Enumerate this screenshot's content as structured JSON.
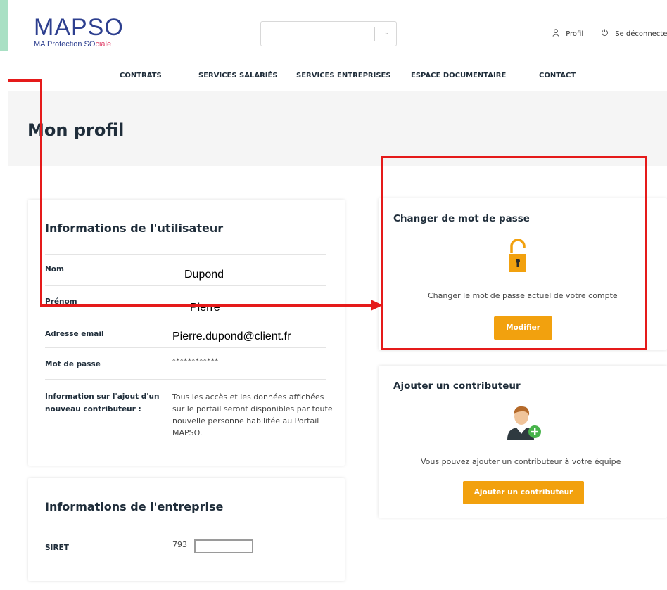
{
  "header": {
    "logo_main": "MAPSO",
    "logo_sub_prefix": "MA Protection SO",
    "logo_sub_suffix": "ciale",
    "select_value": "",
    "profile_icon": "user-icon",
    "profile_label": "Profil",
    "logout_icon": "power-icon",
    "logout_label": "Se déconnecter"
  },
  "nav": {
    "items": [
      {
        "label": "CONTRATS"
      },
      {
        "label": "SERVICES SALARIÉS"
      },
      {
        "label": "SERVICES ENTREPRISES"
      },
      {
        "label": "ESPACE DOCUMENTAIRE"
      },
      {
        "label": "CONTACT"
      }
    ]
  },
  "page": {
    "title": "Mon profil"
  },
  "user_info": {
    "title": "Informations de l'utilisateur",
    "nom_label": "Nom",
    "nom_value": "Dupond",
    "prenom_label": "Prénom",
    "prenom_value": "Pierre",
    "email_label": "Adresse email",
    "email_value": "Pierre.dupond@client.fr",
    "password_label": "Mot de passe",
    "password_value": "************",
    "contrib_label_line1": "Information sur l'ajout d'un",
    "contrib_label_line2": "nouveau contributeur :",
    "contrib_text": "Tous les accès et les données affichées sur le portail seront disponibles par toute nouvelle personne habilitée au Portail MAPSO."
  },
  "company_info": {
    "title": "Informations de l'entreprise",
    "siret_label": "SIRET",
    "siret_value": "793"
  },
  "password_card": {
    "title": "Changer de mot de passe",
    "icon": "padlock-open-icon",
    "description": "Changer le mot de passe actuel de votre compte",
    "button_label": "Modifier"
  },
  "contributor_card": {
    "title": "Ajouter un contributeur",
    "icon": "add-user-avatar-icon",
    "description": "Vous pouvez ajouter un contributeur à votre équipe",
    "button_label": "Ajouter un contributeur"
  },
  "colors": {
    "brand_blue": "#2d3f8f",
    "brand_pink": "#e0436b",
    "accent_orange": "#f2a10e",
    "annotation_red": "#e51a1a",
    "top_band_green": "#a9e0c4"
  }
}
